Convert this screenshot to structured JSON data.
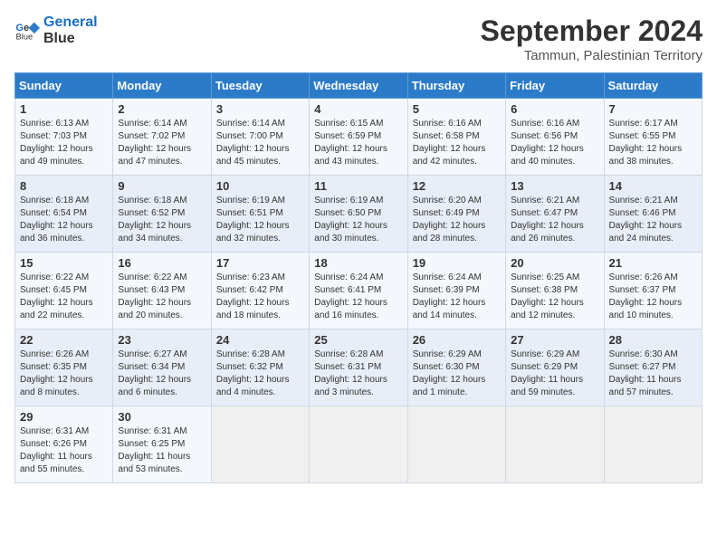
{
  "logo": {
    "line1": "General",
    "line2": "Blue"
  },
  "title": "September 2024",
  "location": "Tammun, Palestinian Territory",
  "days_header": [
    "Sunday",
    "Monday",
    "Tuesday",
    "Wednesday",
    "Thursday",
    "Friday",
    "Saturday"
  ],
  "weeks": [
    [
      {
        "day": "1",
        "lines": [
          "Sunrise: 6:13 AM",
          "Sunset: 7:03 PM",
          "Daylight: 12 hours",
          "and 49 minutes."
        ]
      },
      {
        "day": "2",
        "lines": [
          "Sunrise: 6:14 AM",
          "Sunset: 7:02 PM",
          "Daylight: 12 hours",
          "and 47 minutes."
        ]
      },
      {
        "day": "3",
        "lines": [
          "Sunrise: 6:14 AM",
          "Sunset: 7:00 PM",
          "Daylight: 12 hours",
          "and 45 minutes."
        ]
      },
      {
        "day": "4",
        "lines": [
          "Sunrise: 6:15 AM",
          "Sunset: 6:59 PM",
          "Daylight: 12 hours",
          "and 43 minutes."
        ]
      },
      {
        "day": "5",
        "lines": [
          "Sunrise: 6:16 AM",
          "Sunset: 6:58 PM",
          "Daylight: 12 hours",
          "and 42 minutes."
        ]
      },
      {
        "day": "6",
        "lines": [
          "Sunrise: 6:16 AM",
          "Sunset: 6:56 PM",
          "Daylight: 12 hours",
          "and 40 minutes."
        ]
      },
      {
        "day": "7",
        "lines": [
          "Sunrise: 6:17 AM",
          "Sunset: 6:55 PM",
          "Daylight: 12 hours",
          "and 38 minutes."
        ]
      }
    ],
    [
      {
        "day": "8",
        "lines": [
          "Sunrise: 6:18 AM",
          "Sunset: 6:54 PM",
          "Daylight: 12 hours",
          "and 36 minutes."
        ]
      },
      {
        "day": "9",
        "lines": [
          "Sunrise: 6:18 AM",
          "Sunset: 6:52 PM",
          "Daylight: 12 hours",
          "and 34 minutes."
        ]
      },
      {
        "day": "10",
        "lines": [
          "Sunrise: 6:19 AM",
          "Sunset: 6:51 PM",
          "Daylight: 12 hours",
          "and 32 minutes."
        ]
      },
      {
        "day": "11",
        "lines": [
          "Sunrise: 6:19 AM",
          "Sunset: 6:50 PM",
          "Daylight: 12 hours",
          "and 30 minutes."
        ]
      },
      {
        "day": "12",
        "lines": [
          "Sunrise: 6:20 AM",
          "Sunset: 6:49 PM",
          "Daylight: 12 hours",
          "and 28 minutes."
        ]
      },
      {
        "day": "13",
        "lines": [
          "Sunrise: 6:21 AM",
          "Sunset: 6:47 PM",
          "Daylight: 12 hours",
          "and 26 minutes."
        ]
      },
      {
        "day": "14",
        "lines": [
          "Sunrise: 6:21 AM",
          "Sunset: 6:46 PM",
          "Daylight: 12 hours",
          "and 24 minutes."
        ]
      }
    ],
    [
      {
        "day": "15",
        "lines": [
          "Sunrise: 6:22 AM",
          "Sunset: 6:45 PM",
          "Daylight: 12 hours",
          "and 22 minutes."
        ]
      },
      {
        "day": "16",
        "lines": [
          "Sunrise: 6:22 AM",
          "Sunset: 6:43 PM",
          "Daylight: 12 hours",
          "and 20 minutes."
        ]
      },
      {
        "day": "17",
        "lines": [
          "Sunrise: 6:23 AM",
          "Sunset: 6:42 PM",
          "Daylight: 12 hours",
          "and 18 minutes."
        ]
      },
      {
        "day": "18",
        "lines": [
          "Sunrise: 6:24 AM",
          "Sunset: 6:41 PM",
          "Daylight: 12 hours",
          "and 16 minutes."
        ]
      },
      {
        "day": "19",
        "lines": [
          "Sunrise: 6:24 AM",
          "Sunset: 6:39 PM",
          "Daylight: 12 hours",
          "and 14 minutes."
        ]
      },
      {
        "day": "20",
        "lines": [
          "Sunrise: 6:25 AM",
          "Sunset: 6:38 PM",
          "Daylight: 12 hours",
          "and 12 minutes."
        ]
      },
      {
        "day": "21",
        "lines": [
          "Sunrise: 6:26 AM",
          "Sunset: 6:37 PM",
          "Daylight: 12 hours",
          "and 10 minutes."
        ]
      }
    ],
    [
      {
        "day": "22",
        "lines": [
          "Sunrise: 6:26 AM",
          "Sunset: 6:35 PM",
          "Daylight: 12 hours",
          "and 8 minutes."
        ]
      },
      {
        "day": "23",
        "lines": [
          "Sunrise: 6:27 AM",
          "Sunset: 6:34 PM",
          "Daylight: 12 hours",
          "and 6 minutes."
        ]
      },
      {
        "day": "24",
        "lines": [
          "Sunrise: 6:28 AM",
          "Sunset: 6:32 PM",
          "Daylight: 12 hours",
          "and 4 minutes."
        ]
      },
      {
        "day": "25",
        "lines": [
          "Sunrise: 6:28 AM",
          "Sunset: 6:31 PM",
          "Daylight: 12 hours",
          "and 3 minutes."
        ]
      },
      {
        "day": "26",
        "lines": [
          "Sunrise: 6:29 AM",
          "Sunset: 6:30 PM",
          "Daylight: 12 hours",
          "and 1 minute."
        ]
      },
      {
        "day": "27",
        "lines": [
          "Sunrise: 6:29 AM",
          "Sunset: 6:29 PM",
          "Daylight: 11 hours",
          "and 59 minutes."
        ]
      },
      {
        "day": "28",
        "lines": [
          "Sunrise: 6:30 AM",
          "Sunset: 6:27 PM",
          "Daylight: 11 hours",
          "and 57 minutes."
        ]
      }
    ],
    [
      {
        "day": "29",
        "lines": [
          "Sunrise: 6:31 AM",
          "Sunset: 6:26 PM",
          "Daylight: 11 hours",
          "and 55 minutes."
        ]
      },
      {
        "day": "30",
        "lines": [
          "Sunrise: 6:31 AM",
          "Sunset: 6:25 PM",
          "Daylight: 11 hours",
          "and 53 minutes."
        ]
      },
      {
        "day": "",
        "lines": []
      },
      {
        "day": "",
        "lines": []
      },
      {
        "day": "",
        "lines": []
      },
      {
        "day": "",
        "lines": []
      },
      {
        "day": "",
        "lines": []
      }
    ]
  ]
}
